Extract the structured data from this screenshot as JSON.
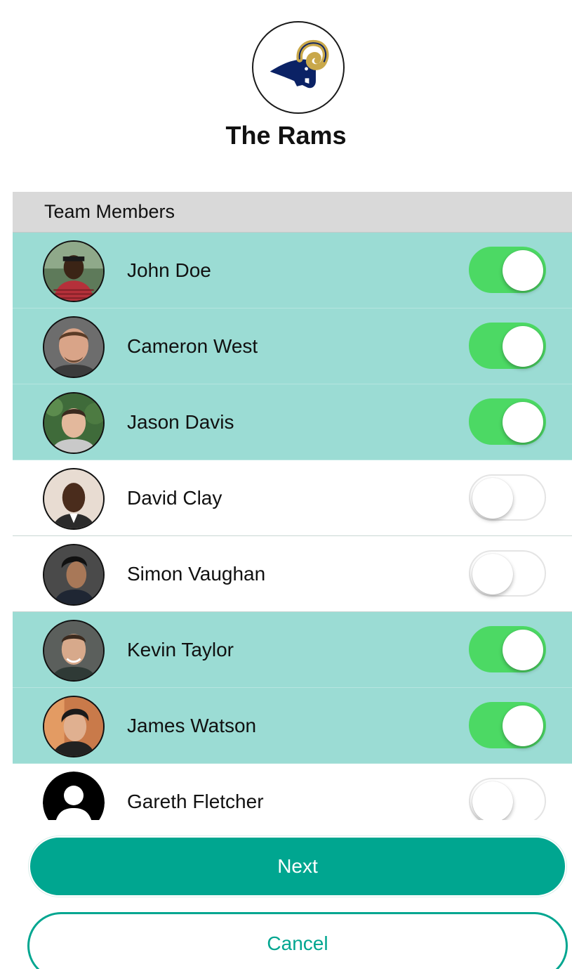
{
  "team": {
    "name": "The Rams",
    "logo_icon": "rams-logo-icon"
  },
  "section": {
    "title": "Team Members"
  },
  "members": [
    {
      "name": "John Doe",
      "selected": true
    },
    {
      "name": "Cameron West",
      "selected": true
    },
    {
      "name": "Jason Davis",
      "selected": true
    },
    {
      "name": "David Clay",
      "selected": false
    },
    {
      "name": "Simon Vaughan",
      "selected": false
    },
    {
      "name": "Kevin Taylor",
      "selected": true
    },
    {
      "name": "James Watson",
      "selected": true
    },
    {
      "name": "Gareth Fletcher",
      "selected": false
    }
  ],
  "actions": {
    "next_label": "Next",
    "cancel_label": "Cancel"
  },
  "colors": {
    "accent": "#00a690",
    "selected_row": "#9bdcd4",
    "toggle_on": "#4cd964",
    "section_header": "#d9d9d9"
  }
}
